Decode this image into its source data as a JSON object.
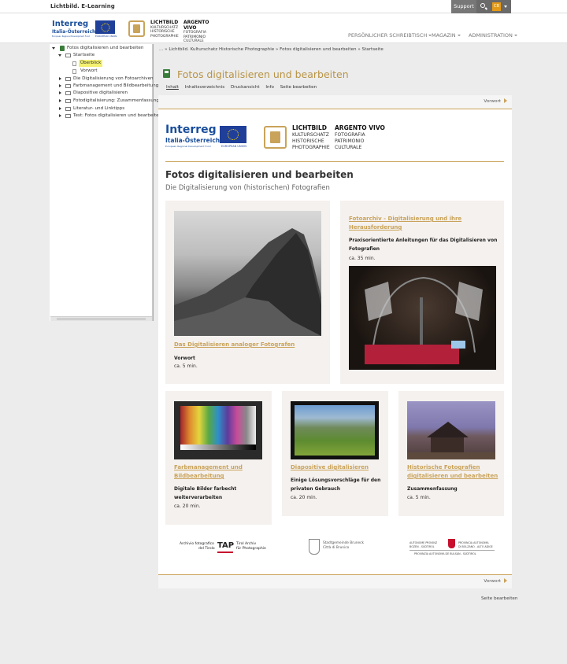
{
  "topbar": {
    "site_title": "Lichtbild. E-Learning",
    "support_label": "Support",
    "search_icon": "search-icon",
    "user_initials": "CB"
  },
  "header": {
    "interreg_word": "Interreg",
    "interreg_region": "Italia-Österreich",
    "interreg_fund": "European Regional Development Fund",
    "eu_label": "EUROPEAN UNION",
    "lichtbild": {
      "title": "LICHTBILD",
      "lines": [
        "KULTURSCHATZ",
        "HISTORISCHE",
        "PHOTOGRAPHIE"
      ]
    },
    "argento": {
      "title": "ARGENTO VIVO",
      "lines": [
        "FOTOGRAFIA",
        "PATRIMONIO",
        "CULTURALE"
      ]
    },
    "nav": [
      "PERSÖNLICHER SCHREIBTISCH",
      "MAGAZIN",
      "ADMINISTRATION"
    ]
  },
  "sidebar": {
    "root": "Fotos digitalisieren und bearbeiten",
    "startseite": "Startseite",
    "startseite_children": [
      "Überblick",
      "Vorwort"
    ],
    "items": [
      "Die Digitalisierung von Fotoarchiven",
      "Farbmanagement und Bildbearbeitung",
      "Diapositive digitalisieren",
      "Fotodigitalisierung: Zusammenfassung",
      "Literatur- und Linktipps",
      "Test: Fotos digitalisieren und bearbeiten"
    ]
  },
  "breadcrumb": {
    "text": "... » Lichtbild. Kulturschatz Historische Photographie » Fotos digitalisieren und bearbeiten » Startseite"
  },
  "page": {
    "title": "Fotos digitalisieren und bearbeiten",
    "tabs": [
      "Inhalt",
      "Inhaltsverzeichnis",
      "Druckansicht",
      "Info",
      "Seite bearbeiten"
    ],
    "nav_next": "Vorwort"
  },
  "content": {
    "heading": "Fotos digitalisieren und bearbeiten",
    "subheading": "Die Digitalisierung von (historischen) Fotografien",
    "cards": [
      {
        "title": "Das Digitalisieren analoger Fotografen",
        "desc": "Vorwort",
        "dur": "ca. 5 min."
      },
      {
        "title": "Fotoarchiv - Digitalisierung und ihre Herausforderung",
        "desc": "Praxisorientierte Anleitungen für das Digitalisieren von Fotografien",
        "dur": "ca. 35 min."
      },
      {
        "title": "Farbmanagement und Bildbearbeitung",
        "desc": "Digitale Bilder farbecht weiterverarbeiten",
        "dur": "ca. 20 min."
      },
      {
        "title": "Diapositive digitalisieren",
        "desc": "Einige Lösungsvorschläge für den privaten Gebrauch",
        "dur": "ca. 20 min."
      },
      {
        "title": "Historische Fotografien digitalisieren und bearbeiten",
        "desc": "Zusammenfassung",
        "dur": "ca. 5 min."
      }
    ],
    "footer_logos": {
      "tap_left": [
        "Archivio fotografico",
        "del Tirolo"
      ],
      "tap_right": [
        "Tirol Archiv",
        "für Photographie"
      ],
      "tap_mark": "TAP",
      "bruneck": [
        "Stadtgemeinde Bruneck",
        "Città di Brunico"
      ],
      "provinz_left": [
        "AUTONOME PROVINZ",
        "BOZEN - SÜDTIROL"
      ],
      "provinz_right": [
        "PROVINCIA AUTONOMA",
        "DI BOLZANO - ALTO ADIGE"
      ],
      "provinz_bottom": "PROVINZIA AUTONOMA DE BULSAN - SÜDTIROL"
    }
  },
  "footer": {
    "edit_label": "Seite bearbeiten"
  },
  "colors": {
    "gold": "#c9a35a",
    "title_gold": "#b89446",
    "green": "#3a7d3a",
    "card_bg": "#f5f1ee",
    "eu_blue": "#1f3f99"
  }
}
